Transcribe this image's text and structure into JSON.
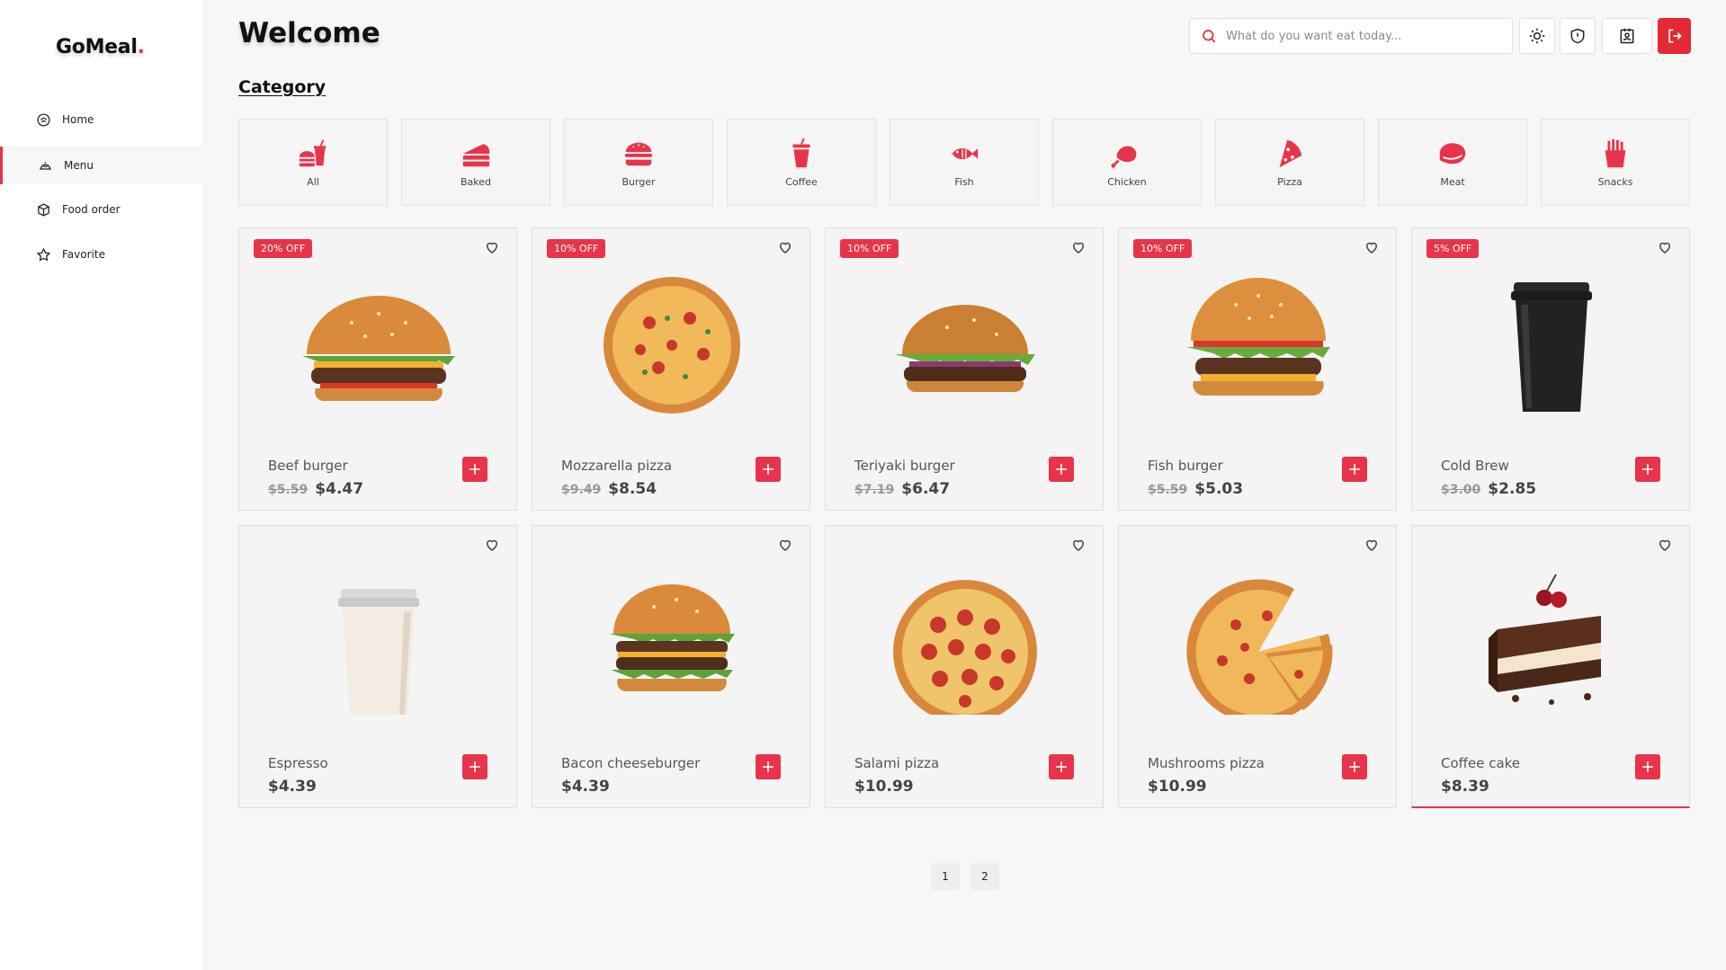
{
  "app": {
    "logo_text": "GoMeal",
    "logo_dot": "."
  },
  "sidebar": {
    "items": [
      {
        "label": "Home",
        "icon": "home-icon",
        "active": false
      },
      {
        "label": "Menu",
        "icon": "menu-icon",
        "active": true
      },
      {
        "label": "Food order",
        "icon": "box-icon",
        "active": false
      },
      {
        "label": "Favorite",
        "icon": "star-icon",
        "active": false
      }
    ]
  },
  "header": {
    "title": "Welcome",
    "search_placeholder": "What do you want eat today...",
    "icons": [
      "sun-icon",
      "shield-icon",
      "profile-card-icon",
      "logout-icon"
    ]
  },
  "category": {
    "title": "Category",
    "items": [
      {
        "label": "All",
        "icon": "fastfood-icon"
      },
      {
        "label": "Baked",
        "icon": "cake-icon"
      },
      {
        "label": "Burger",
        "icon": "burger-icon"
      },
      {
        "label": "Coffee",
        "icon": "cup-icon"
      },
      {
        "label": "Fish",
        "icon": "fish-icon"
      },
      {
        "label": "Chicken",
        "icon": "drumstick-icon"
      },
      {
        "label": "Pizza",
        "icon": "pizza-icon"
      },
      {
        "label": "Meat",
        "icon": "steak-icon"
      },
      {
        "label": "Snacks",
        "icon": "fries-icon"
      }
    ]
  },
  "products": [
    {
      "name": "Beef burger",
      "badge": "20% OFF",
      "old_price": "$5.59",
      "price": "$4.47",
      "image": "burger"
    },
    {
      "name": "Mozzarella pizza",
      "badge": "10% OFF",
      "old_price": "$9.49",
      "price": "$8.54",
      "image": "pizza"
    },
    {
      "name": "Teriyaki burger",
      "badge": "10% OFF",
      "old_price": "$7.19",
      "price": "$6.47",
      "image": "burger"
    },
    {
      "name": "Fish burger",
      "badge": "10% OFF",
      "old_price": "$5.59",
      "price": "$5.03",
      "image": "burger"
    },
    {
      "name": "Cold Brew",
      "badge": "5% OFF",
      "old_price": "$3.00",
      "price": "$2.85",
      "image": "black-cup"
    },
    {
      "name": "Espresso",
      "badge": "",
      "old_price": "",
      "price": "$4.39",
      "image": "white-cup"
    },
    {
      "name": "Bacon cheeseburger",
      "badge": "",
      "old_price": "",
      "price": "$4.39",
      "image": "burger"
    },
    {
      "name": "Salami pizza",
      "badge": "",
      "old_price": "",
      "price": "$10.99",
      "image": "pepperoni"
    },
    {
      "name": "Mushrooms pizza",
      "badge": "",
      "old_price": "",
      "price": "$10.99",
      "image": "pizza-slice"
    },
    {
      "name": "Coffee cake",
      "badge": "",
      "old_price": "",
      "price": "$8.39",
      "image": "cake"
    }
  ],
  "pagination": {
    "pages": [
      "1",
      "2"
    ]
  },
  "colors": {
    "accent": "#e8344a",
    "logout": "#e32a33",
    "background": "#f7f7f7"
  }
}
